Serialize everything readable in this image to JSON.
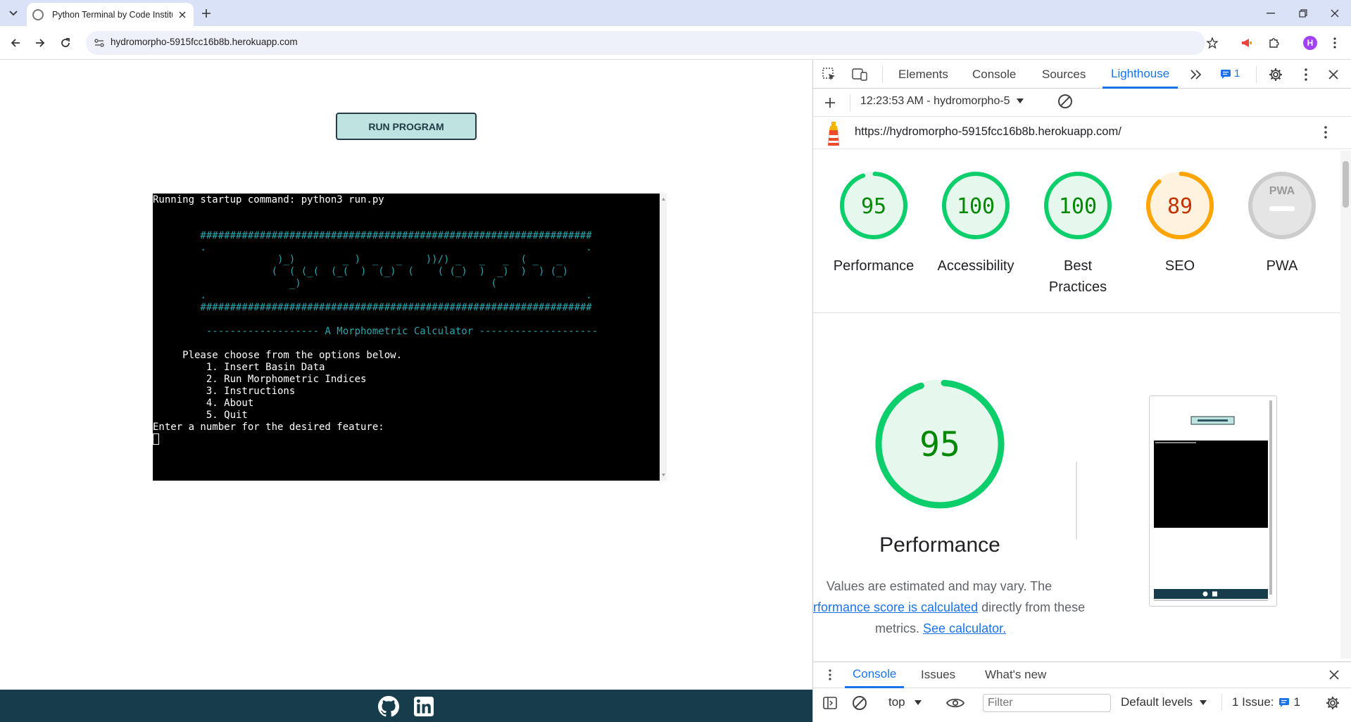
{
  "browser": {
    "tab_title": "Python Terminal by Code Institute",
    "url": "hydromorpho-5915fcc16b8b.herokuapp.com",
    "avatar_letter": "H"
  },
  "page": {
    "run_button": "RUN PROGRAM",
    "terminal_lines": [
      {
        "text": "Running startup command: python3 run.py",
        "cls": ""
      },
      {
        "text": "",
        "cls": ""
      },
      {
        "text": "",
        "cls": ""
      },
      {
        "text": "        ##################################################################",
        "cls": "cyan"
      },
      {
        "text": "        .                                                                .",
        "cls": "cyan"
      },
      {
        "text": "                     )_)        _ )  _   _    ))/) _   _   _  ( _   _",
        "cls": "cyan"
      },
      {
        "text": "                    (  ( (_(  (_(  )  (_)  (    ( (_)  )  _)  )  ) (_)",
        "cls": "cyan"
      },
      {
        "text": "                       _)                                (",
        "cls": "cyan"
      },
      {
        "text": "        .                                                                .",
        "cls": "cyan"
      },
      {
        "text": "        ##################################################################",
        "cls": "cyan"
      },
      {
        "text": "",
        "cls": ""
      },
      {
        "text": "         ------------------- A Morphometric Calculator --------------------",
        "cls": "cyan"
      },
      {
        "text": "",
        "cls": ""
      },
      {
        "text": "     Please choose from the options below.",
        "cls": ""
      },
      {
        "text": "         1. Insert Basin Data",
        "cls": ""
      },
      {
        "text": "         2. Run Morphometric Indices",
        "cls": ""
      },
      {
        "text": "         3. Instructions",
        "cls": ""
      },
      {
        "text": "         4. About",
        "cls": ""
      },
      {
        "text": "         5. Quit",
        "cls": ""
      },
      {
        "text": "Enter a number for the desired feature:",
        "cls": ""
      }
    ]
  },
  "devtools": {
    "tabs": [
      "Elements",
      "Console",
      "Sources",
      "Lighthouse"
    ],
    "active_tab": "Lighthouse",
    "issues_count": "1",
    "report_selector": "12:23:53 AM - hydromorpho-5",
    "report_url": "https://hydromorpho-5915fcc16b8b.herokuapp.com/",
    "scores": [
      {
        "label": "Performance",
        "value": "95",
        "color": "#0cce6b",
        "text_color": "#008800",
        "bg": "#e6f7ee",
        "fraction": 0.95
      },
      {
        "label": "Accessibility",
        "value": "100",
        "color": "#0cce6b",
        "text_color": "#008800",
        "bg": "#e6f7ee",
        "fraction": 1.0
      },
      {
        "label": "Best Practices",
        "value": "100",
        "color": "#0cce6b",
        "text_color": "#008800",
        "bg": "#e6f7ee",
        "fraction": 1.0
      },
      {
        "label": "SEO",
        "value": "89",
        "color": "#ffa400",
        "text_color": "#c33300",
        "bg": "#fff3e0",
        "fraction": 0.89
      },
      {
        "label": "PWA",
        "value": "PWA",
        "color": "#cccccc",
        "text_color": "#888888",
        "bg": "#e5e5e5",
        "fraction": 0
      }
    ],
    "big_score": {
      "value": "95",
      "label": "Performance",
      "fraction": 0.95
    },
    "desc_prefix": "Values are estimated and may vary. The",
    "desc_link1": "rformance score is calculated",
    "desc_mid": "directly from these",
    "desc_line3_prefix": "metrics.",
    "desc_link2": "See calculator.",
    "drawer_tabs": [
      "Console",
      "Issues",
      "What's new"
    ],
    "console": {
      "context": "top",
      "filter_placeholder": "Filter",
      "levels": "Default levels",
      "issues_label": "1 Issue:",
      "issues_num": "1"
    }
  }
}
